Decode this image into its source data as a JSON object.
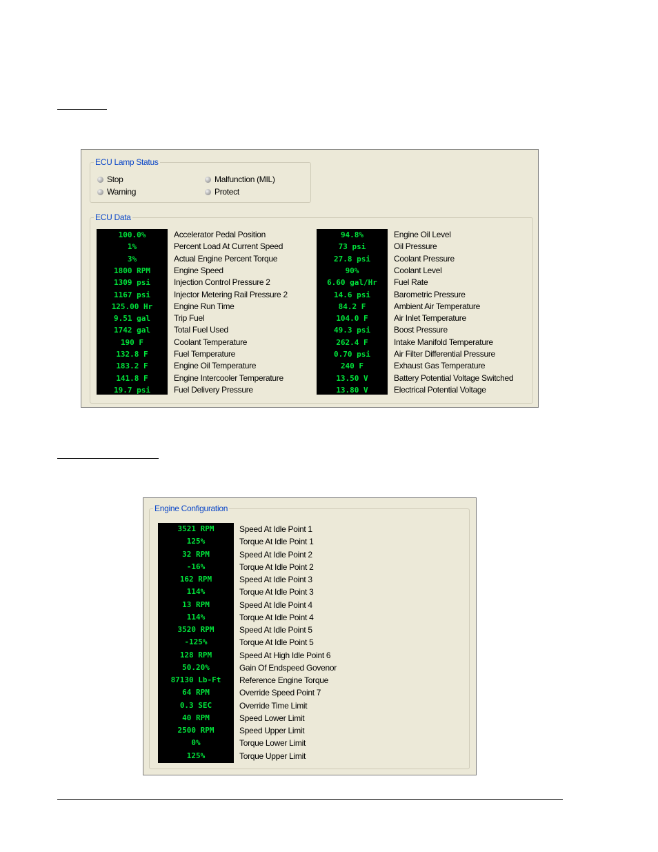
{
  "ecu_panel": {
    "lamp_status": {
      "title": "ECU Lamp Status",
      "lamps": [
        {
          "label": "Stop"
        },
        {
          "label": "Warning"
        },
        {
          "label": "Malfunction (MIL)"
        },
        {
          "label": "Protect"
        }
      ]
    },
    "ecu_data": {
      "title": "ECU Data",
      "left": [
        {
          "value": "100.0%",
          "label": "Accelerator Pedal Position"
        },
        {
          "value": "1%",
          "label": "Percent Load At Current Speed"
        },
        {
          "value": "3%",
          "label": "Actual Engine Percent Torque"
        },
        {
          "value": "1800 RPM",
          "label": "Engine Speed"
        },
        {
          "value": "1309 psi",
          "label": "Injection Control Pressure 2"
        },
        {
          "value": "1167 psi",
          "label": "Injector Metering Rail Pressure 2"
        },
        {
          "value": "125.00 Hr",
          "label": "Engine Run Time"
        },
        {
          "value": "9.51 gal",
          "label": "Trip Fuel"
        },
        {
          "value": "1742 gal",
          "label": "Total Fuel Used"
        },
        {
          "value": "190 F",
          "label": "Coolant Temperature"
        },
        {
          "value": "132.8 F",
          "label": "Fuel Temperature"
        },
        {
          "value": "183.2 F",
          "label": "Engine Oil Temperature"
        },
        {
          "value": "141.8 F",
          "label": "Engine Intercooler Temperature"
        },
        {
          "value": "19.7 psi",
          "label": "Fuel Delivery Pressure"
        }
      ],
      "right": [
        {
          "value": "94.8%",
          "label": "Engine Oil Level"
        },
        {
          "value": "73 psi",
          "label": "Oil Pressure"
        },
        {
          "value": "27.8 psi",
          "label": "Coolant Pressure"
        },
        {
          "value": "90%",
          "label": "Coolant Level"
        },
        {
          "value": "6.60 gal/Hr",
          "label": "Fuel Rate"
        },
        {
          "value": "14.6 psi",
          "label": "Barometric Pressure"
        },
        {
          "value": "84.2 F",
          "label": "Ambient Air Temperature"
        },
        {
          "value": "104.0 F",
          "label": "Air Inlet Temperature"
        },
        {
          "value": "49.3 psi",
          "label": "Boost Pressure"
        },
        {
          "value": "262.4 F",
          "label": "Intake Manifold Temperature"
        },
        {
          "value": "0.70 psi",
          "label": "Air Filter Differential Pressure"
        },
        {
          "value": "240 F",
          "label": "Exhaust Gas Temperature"
        },
        {
          "value": "13.50 V",
          "label": "Battery Potential Voltage Switched"
        },
        {
          "value": "13.80 V",
          "label": "Electrical Potential Voltage"
        }
      ]
    }
  },
  "engine_config": {
    "title": "Engine Configuration",
    "rows": [
      {
        "value": "3521 RPM",
        "label": "Speed At Idle Point 1"
      },
      {
        "value": "125%",
        "label": "Torque At Idle Point 1"
      },
      {
        "value": "32 RPM",
        "label": "Speed At Idle Point 2"
      },
      {
        "value": "-16%",
        "label": "Torque At Idle Point 2"
      },
      {
        "value": "162 RPM",
        "label": "Speed At Idle Point 3"
      },
      {
        "value": "114%",
        "label": "Torque At Idle Point 3"
      },
      {
        "value": "13 RPM",
        "label": "Speed At Idle Point 4"
      },
      {
        "value": "114%",
        "label": "Torque At Idle Point 4"
      },
      {
        "value": "3520 RPM",
        "label": "Speed At Idle Point 5"
      },
      {
        "value": "-125%",
        "label": "Torque At Idle Point 5"
      },
      {
        "value": "128 RPM",
        "label": "Speed At High Idle Point 6"
      },
      {
        "value": "50.20%",
        "label": "Gain Of Endspeed Govenor"
      },
      {
        "value": "87130 Lb-Ft",
        "label": "Reference Engine Torque"
      },
      {
        "value": "64 RPM",
        "label": "Override Speed Point 7"
      },
      {
        "value": "0.3 SEC",
        "label": "Override Time Limit"
      },
      {
        "value": "40 RPM",
        "label": "Speed Lower Limit"
      },
      {
        "value": "2500 RPM",
        "label": "Speed Upper Limit"
      },
      {
        "value": "0%",
        "label": "Torque Lower Limit"
      },
      {
        "value": "125%",
        "label": "Torque Upper Limit"
      }
    ]
  },
  "colors": {
    "panel_bg": "#ece9d8",
    "legend_text": "#0a46c8",
    "lcd_bg": "#000000",
    "lcd_text": "#00e23a"
  }
}
